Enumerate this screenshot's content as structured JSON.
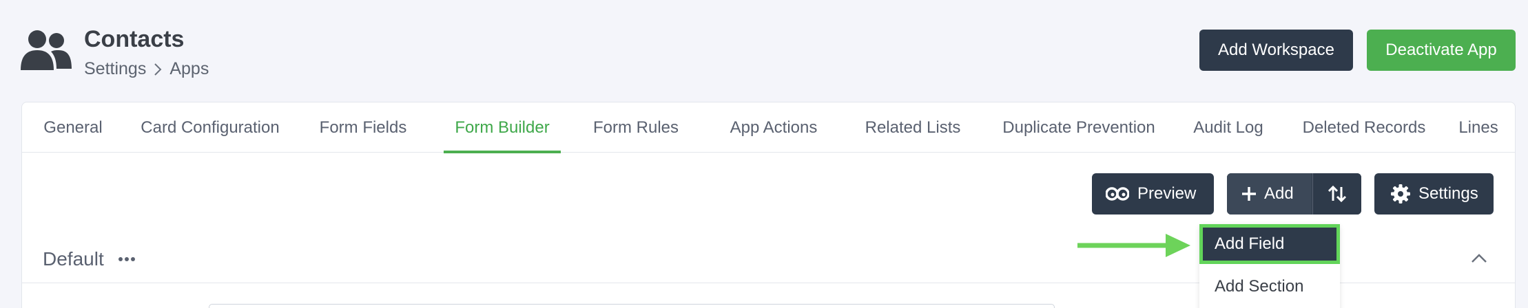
{
  "header": {
    "title": "Contacts",
    "breadcrumb": [
      "Settings",
      "Apps"
    ],
    "icon": "users-icon",
    "add_workspace_label": "Add Workspace",
    "deactivate_label": "Deactivate App"
  },
  "tabs": [
    {
      "label": "General"
    },
    {
      "label": "Card Configuration"
    },
    {
      "label": "Form Fields"
    },
    {
      "label": "Form Builder",
      "active": true
    },
    {
      "label": "Form Rules"
    },
    {
      "label": "App Actions"
    },
    {
      "label": "Related Lists"
    },
    {
      "label": "Duplicate Prevention"
    },
    {
      "label": "Audit Log"
    },
    {
      "label": "Deleted Records"
    },
    {
      "label": "Lines"
    }
  ],
  "toolbar": {
    "preview_label": "Preview",
    "add_label": "Add",
    "settings_label": "Settings"
  },
  "section": {
    "label": "Default"
  },
  "dropdown": {
    "items": [
      {
        "label": "Add Field",
        "highlighted": true
      },
      {
        "label": "Add Section"
      }
    ]
  },
  "colors": {
    "background": "#f4f5fa",
    "dark_button": "#2e3a4a",
    "green_button": "#4caf50",
    "active_tab": "#3fa84a",
    "highlight_border": "#62d45a"
  }
}
